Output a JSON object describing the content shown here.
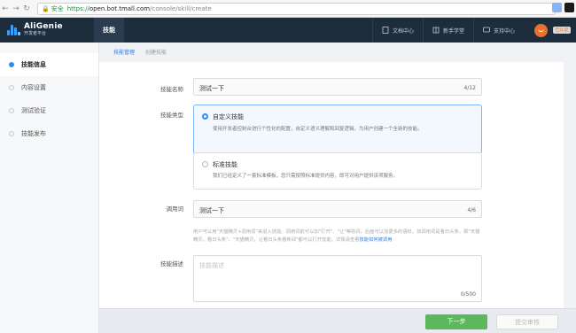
{
  "browser": {
    "secure_label": "安全",
    "url_scheme": "https://",
    "url_host": "open.bot.tmall.com",
    "url_path": "/console/skill/create"
  },
  "brand": {
    "name": "AliGenie",
    "subtitle": "开发者平台"
  },
  "header": {
    "nav_tab": "技能",
    "links": [
      "文档中心",
      "新手学堂",
      "支持中心"
    ],
    "user_badge": "已认证"
  },
  "sidebar": {
    "items": [
      {
        "label": "技能信息"
      },
      {
        "label": "内容设置"
      },
      {
        "label": "测试验证"
      },
      {
        "label": "技能发布"
      }
    ]
  },
  "breadcrumb": [
    "技能管理",
    "创建技能"
  ],
  "form": {
    "name": {
      "label": "技能名称",
      "value": "测试一下",
      "count": "4/12"
    },
    "type": {
      "label": "技能类型",
      "custom": {
        "title": "自定义技能",
        "desc": "使用开发者控制台进行个性化的配置，自定义语义理解和回复逻辑，为用户创建一个全新的技能。"
      },
      "standard": {
        "title": "标准技能",
        "desc": "我们已经定义了一套标准模板，您只需按照标准提供内容，即可对用户提供该项服务。"
      }
    },
    "invocation": {
      "label": "调用词",
      "value": "测试一下",
      "count": "4/6",
      "hint": "用户可以用\"天猫精灵+调用词\"来进入技能。调用词前可以加\"打开\"、\"让\"等助词，后面可以加更多的语料。如调用词是看日头条，那\"天猫精灵，看日头条\"、\"天猫精灵，让看日头条看新闻\"都可以打开技能。详情请查看",
      "hint_link": "技能如何被调用"
    },
    "description": {
      "label": "技能描述",
      "placeholder": "技能描述",
      "count": "0/500"
    }
  },
  "actions": {
    "next": "下一步",
    "submit": "提交审核"
  }
}
